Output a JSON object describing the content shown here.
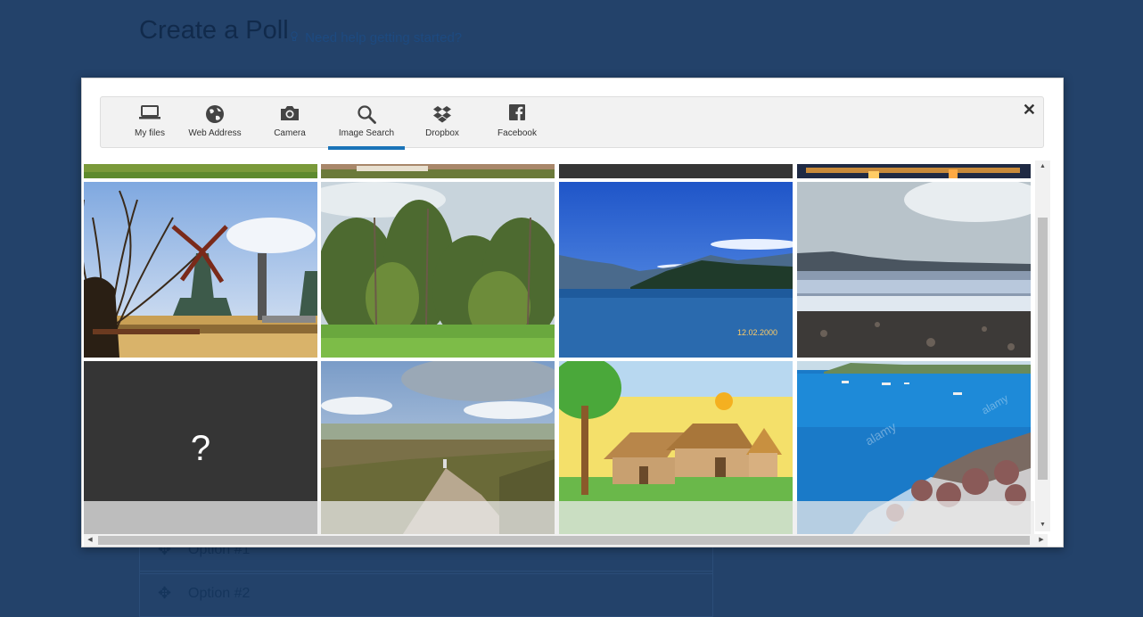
{
  "page": {
    "title": "Create a Poll",
    "help_link": "Need help getting started?",
    "options": [
      "Option #1",
      "Option #2"
    ]
  },
  "modal": {
    "tabs": [
      {
        "label": "My files",
        "icon": "laptop-icon"
      },
      {
        "label": "Web Address",
        "icon": "globe-icon"
      },
      {
        "label": "Camera",
        "icon": "camera-icon"
      },
      {
        "label": "Image Search",
        "icon": "search-icon",
        "active": true
      },
      {
        "label": "Dropbox",
        "icon": "dropbox-icon"
      },
      {
        "label": "Facebook",
        "icon": "facebook-icon"
      }
    ],
    "close_symbol": "✕",
    "broken_image_symbol": "?"
  },
  "colors": {
    "page_bg": "#23426a",
    "accent": "#1a73b8"
  }
}
